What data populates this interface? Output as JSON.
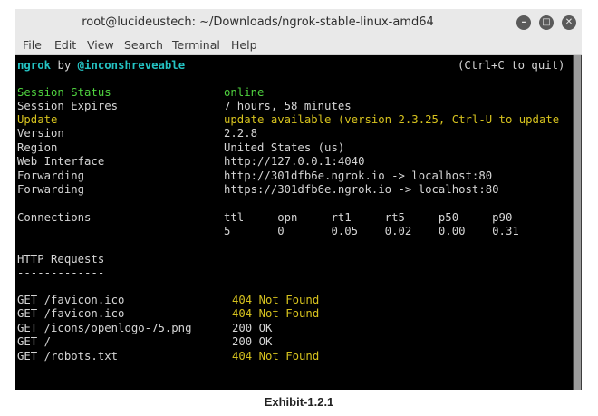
{
  "window": {
    "title": "root@lucideustech: ~/Downloads/ngrok-stable-linux-amd64",
    "controls": [
      "minimize-icon",
      "maximize-icon",
      "close-icon"
    ]
  },
  "menu": {
    "items": [
      "File",
      "Edit",
      "View",
      "Search",
      "Terminal",
      "Help"
    ]
  },
  "terminal": {
    "header_app": "ngrok",
    "header_by": "by",
    "header_author": "@inconshreveable",
    "header_quit": "(Ctrl+C to quit)",
    "status_label": "Session Status",
    "status_value": "online",
    "expires_label": "Session Expires",
    "expires_value": "7 hours, 58 minutes",
    "update_label": "Update",
    "update_value": "update available (version 2.3.25, Ctrl-U to update",
    "version_label": "Version",
    "version_value": "2.2.8",
    "region_label": "Region",
    "region_value": "United States (us)",
    "web_label": "Web Interface",
    "web_value": "http://127.0.0.1:4040",
    "fwd1_label": "Forwarding",
    "fwd1_value": "http://301dfb6e.ngrok.io -> localhost:80",
    "fwd2_label": "Forwarding",
    "fwd2_value": "https://301dfb6e.ngrok.io -> localhost:80",
    "conn_label": "Connections",
    "conn_headers": "ttl     opn     rt1     rt5     p50     p90",
    "conn_values": "5       0       0.05    0.02    0.00    0.31",
    "http_label": "HTTP Requests",
    "http_rule": "-------------",
    "requests": [
      {
        "path": "GET /favicon.ico",
        "status": "404 Not Found"
      },
      {
        "path": "GET /favicon.ico",
        "status": "404 Not Found"
      },
      {
        "path": "GET /icons/openlogo-75.png",
        "status": "200 OK"
      },
      {
        "path": "GET /",
        "status": "200 OK"
      },
      {
        "path": "GET /robots.txt",
        "status": "404 Not Found"
      }
    ]
  },
  "caption": "Exhibit-1.2.1",
  "colors": {
    "terminal_bg": "#000000",
    "green": "#4fd33f",
    "cyan": "#24c3c3",
    "yellow": "#d6c21e",
    "text": "#d5d5d5"
  }
}
